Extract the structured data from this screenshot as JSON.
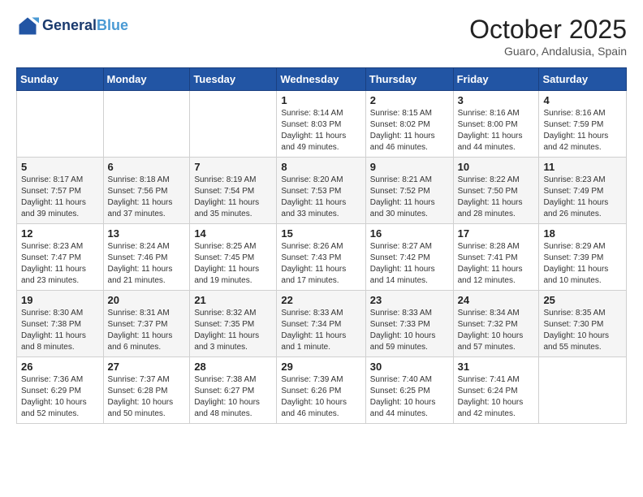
{
  "header": {
    "logo_line1": "General",
    "logo_line2": "Blue",
    "month": "October 2025",
    "location": "Guaro, Andalusia, Spain"
  },
  "weekdays": [
    "Sunday",
    "Monday",
    "Tuesday",
    "Wednesday",
    "Thursday",
    "Friday",
    "Saturday"
  ],
  "weeks": [
    [
      {
        "day": "",
        "info": ""
      },
      {
        "day": "",
        "info": ""
      },
      {
        "day": "",
        "info": ""
      },
      {
        "day": "1",
        "info": "Sunrise: 8:14 AM\nSunset: 8:03 PM\nDaylight: 11 hours\nand 49 minutes."
      },
      {
        "day": "2",
        "info": "Sunrise: 8:15 AM\nSunset: 8:02 PM\nDaylight: 11 hours\nand 46 minutes."
      },
      {
        "day": "3",
        "info": "Sunrise: 8:16 AM\nSunset: 8:00 PM\nDaylight: 11 hours\nand 44 minutes."
      },
      {
        "day": "4",
        "info": "Sunrise: 8:16 AM\nSunset: 7:59 PM\nDaylight: 11 hours\nand 42 minutes."
      }
    ],
    [
      {
        "day": "5",
        "info": "Sunrise: 8:17 AM\nSunset: 7:57 PM\nDaylight: 11 hours\nand 39 minutes."
      },
      {
        "day": "6",
        "info": "Sunrise: 8:18 AM\nSunset: 7:56 PM\nDaylight: 11 hours\nand 37 minutes."
      },
      {
        "day": "7",
        "info": "Sunrise: 8:19 AM\nSunset: 7:54 PM\nDaylight: 11 hours\nand 35 minutes."
      },
      {
        "day": "8",
        "info": "Sunrise: 8:20 AM\nSunset: 7:53 PM\nDaylight: 11 hours\nand 33 minutes."
      },
      {
        "day": "9",
        "info": "Sunrise: 8:21 AM\nSunset: 7:52 PM\nDaylight: 11 hours\nand 30 minutes."
      },
      {
        "day": "10",
        "info": "Sunrise: 8:22 AM\nSunset: 7:50 PM\nDaylight: 11 hours\nand 28 minutes."
      },
      {
        "day": "11",
        "info": "Sunrise: 8:23 AM\nSunset: 7:49 PM\nDaylight: 11 hours\nand 26 minutes."
      }
    ],
    [
      {
        "day": "12",
        "info": "Sunrise: 8:23 AM\nSunset: 7:47 PM\nDaylight: 11 hours\nand 23 minutes."
      },
      {
        "day": "13",
        "info": "Sunrise: 8:24 AM\nSunset: 7:46 PM\nDaylight: 11 hours\nand 21 minutes."
      },
      {
        "day": "14",
        "info": "Sunrise: 8:25 AM\nSunset: 7:45 PM\nDaylight: 11 hours\nand 19 minutes."
      },
      {
        "day": "15",
        "info": "Sunrise: 8:26 AM\nSunset: 7:43 PM\nDaylight: 11 hours\nand 17 minutes."
      },
      {
        "day": "16",
        "info": "Sunrise: 8:27 AM\nSunset: 7:42 PM\nDaylight: 11 hours\nand 14 minutes."
      },
      {
        "day": "17",
        "info": "Sunrise: 8:28 AM\nSunset: 7:41 PM\nDaylight: 11 hours\nand 12 minutes."
      },
      {
        "day": "18",
        "info": "Sunrise: 8:29 AM\nSunset: 7:39 PM\nDaylight: 11 hours\nand 10 minutes."
      }
    ],
    [
      {
        "day": "19",
        "info": "Sunrise: 8:30 AM\nSunset: 7:38 PM\nDaylight: 11 hours\nand 8 minutes."
      },
      {
        "day": "20",
        "info": "Sunrise: 8:31 AM\nSunset: 7:37 PM\nDaylight: 11 hours\nand 6 minutes."
      },
      {
        "day": "21",
        "info": "Sunrise: 8:32 AM\nSunset: 7:35 PM\nDaylight: 11 hours\nand 3 minutes."
      },
      {
        "day": "22",
        "info": "Sunrise: 8:33 AM\nSunset: 7:34 PM\nDaylight: 11 hours\nand 1 minute."
      },
      {
        "day": "23",
        "info": "Sunrise: 8:33 AM\nSunset: 7:33 PM\nDaylight: 10 hours\nand 59 minutes."
      },
      {
        "day": "24",
        "info": "Sunrise: 8:34 AM\nSunset: 7:32 PM\nDaylight: 10 hours\nand 57 minutes."
      },
      {
        "day": "25",
        "info": "Sunrise: 8:35 AM\nSunset: 7:30 PM\nDaylight: 10 hours\nand 55 minutes."
      }
    ],
    [
      {
        "day": "26",
        "info": "Sunrise: 7:36 AM\nSunset: 6:29 PM\nDaylight: 10 hours\nand 52 minutes."
      },
      {
        "day": "27",
        "info": "Sunrise: 7:37 AM\nSunset: 6:28 PM\nDaylight: 10 hours\nand 50 minutes."
      },
      {
        "day": "28",
        "info": "Sunrise: 7:38 AM\nSunset: 6:27 PM\nDaylight: 10 hours\nand 48 minutes."
      },
      {
        "day": "29",
        "info": "Sunrise: 7:39 AM\nSunset: 6:26 PM\nDaylight: 10 hours\nand 46 minutes."
      },
      {
        "day": "30",
        "info": "Sunrise: 7:40 AM\nSunset: 6:25 PM\nDaylight: 10 hours\nand 44 minutes."
      },
      {
        "day": "31",
        "info": "Sunrise: 7:41 AM\nSunset: 6:24 PM\nDaylight: 10 hours\nand 42 minutes."
      },
      {
        "day": "",
        "info": ""
      }
    ]
  ]
}
